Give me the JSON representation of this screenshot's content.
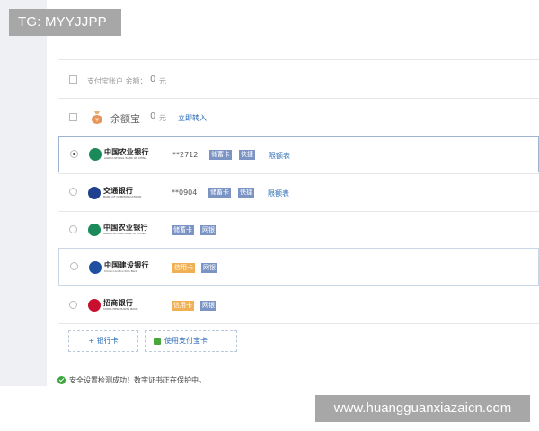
{
  "tag_badge": "TG: MYYJJPP",
  "watermark": "www.huangguanxiazaicn.com",
  "alipay_balance": {
    "label": "支付宝账户 余额：",
    "amount": "0",
    "unit": "元"
  },
  "yuebao": {
    "label": "余额宝",
    "amount": "0",
    "unit": "元",
    "action": "立即转入"
  },
  "banks": [
    {
      "name_cn": "中国农业银行",
      "name_en": "AGRICULTURAL BANK OF CHINA",
      "account": "**2712",
      "tags": [
        "储蓄卡",
        "快捷"
      ],
      "limit_link": "限额表",
      "selected": true
    },
    {
      "name_cn": "交通银行",
      "name_en": "BANK OF COMMUNICATIONS",
      "account": "**0904",
      "tags": [
        "储蓄卡",
        "快捷"
      ],
      "limit_link": "限额表",
      "selected": false
    },
    {
      "name_cn": "中国农业银行",
      "name_en": "AGRICULTURAL BANK OF CHINA",
      "account": "",
      "tags": [
        "储蓄卡",
        "网银"
      ],
      "limit_link": "",
      "selected": false
    },
    {
      "name_cn": "中国建设银行",
      "name_en": "China Construction Bank",
      "account": "",
      "tags": [
        "信用卡",
        "网银"
      ],
      "limit_link": "",
      "selected": false
    },
    {
      "name_cn": "招商银行",
      "name_en": "CHINA MERCHANTS BANK",
      "account": "",
      "tags": [
        "信用卡",
        "网银"
      ],
      "limit_link": "",
      "selected": false
    }
  ],
  "actions": {
    "add_bank": "+ 银行卡",
    "use_alipay_card": "使用支付宝卡"
  },
  "security_message": "安全设置检测成功！数字证书正在保护中。",
  "colors": {
    "link": "#2a6bb5",
    "tag_blue": "#7b94c4",
    "tag_orange": "#f0b154",
    "success": "#3aa53a"
  }
}
